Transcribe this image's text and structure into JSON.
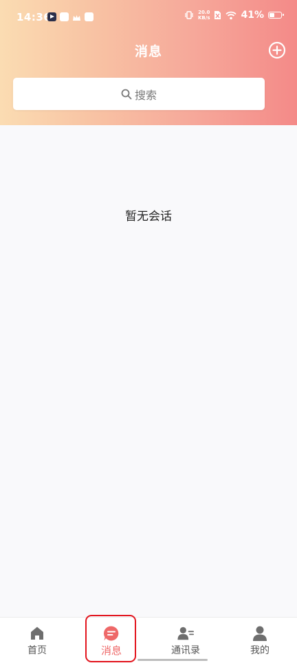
{
  "status_bar": {
    "time": "14:36",
    "net_speed_value": "20.0",
    "net_speed_unit": "KB/s",
    "battery_percent": "41%"
  },
  "header": {
    "title": "消息",
    "search_label": "搜索"
  },
  "main": {
    "empty_text": "暂无会话"
  },
  "bottom_nav": {
    "items": [
      {
        "label": "首页",
        "icon": "home-icon"
      },
      {
        "label": "消息",
        "icon": "message-icon",
        "active": true
      },
      {
        "label": "通讯录",
        "icon": "contacts-icon"
      },
      {
        "label": "我的",
        "icon": "profile-icon"
      }
    ]
  },
  "colors": {
    "gradient_start": "#fbdcb2",
    "gradient_end": "#f48a88",
    "accent": "#ee6868",
    "highlight_box": "#e2141d"
  }
}
